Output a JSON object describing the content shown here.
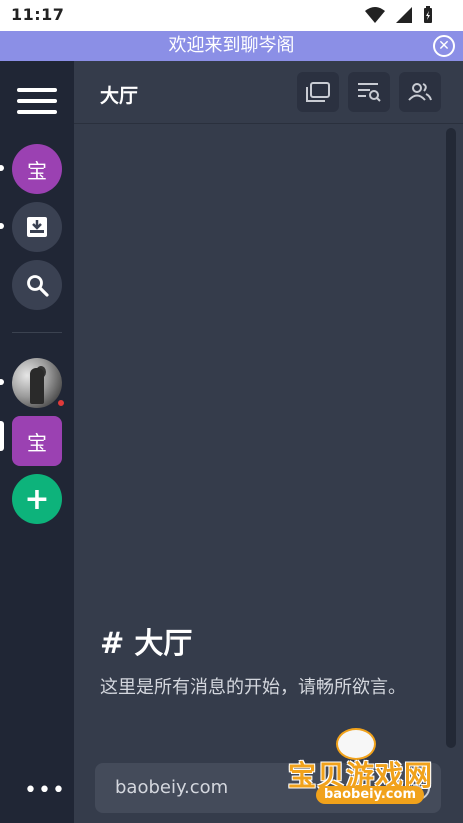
{
  "status": {
    "time": "11:17"
  },
  "banner": {
    "text": "欢迎来到聊岑阁"
  },
  "sidebar": {
    "servers": [
      {
        "label": "宝"
      },
      {
        "label": "宝"
      }
    ],
    "add_label": "+",
    "more_label": "•••"
  },
  "header": {
    "title": "大厅"
  },
  "welcome": {
    "title": "# 大厅",
    "subtitle": "这里是所有消息的开始，请畅所欲言。"
  },
  "input": {
    "value": "baobeiy.com"
  },
  "watermark": {
    "text": "宝贝游戏网",
    "url": "baobeiy.com"
  }
}
